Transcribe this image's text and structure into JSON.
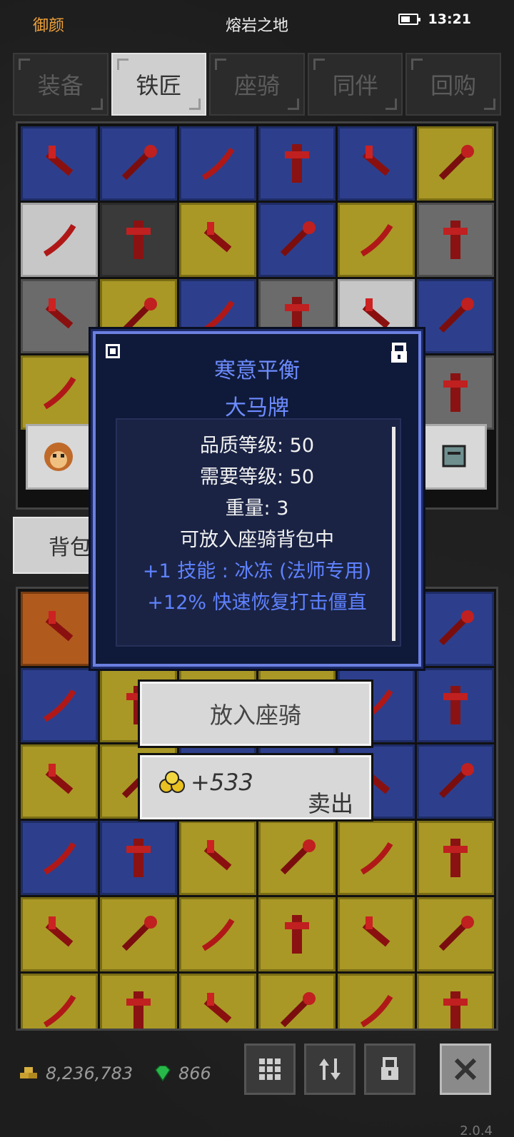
{
  "status_bar": {
    "left_label": "御颜",
    "title": "熔岩之地",
    "time": "13:21"
  },
  "tabs": [
    {
      "label": "装备",
      "active": false
    },
    {
      "label": "铁匠",
      "active": true
    },
    {
      "label": "座骑",
      "active": false
    },
    {
      "label": "同伴",
      "active": false
    },
    {
      "label": "回购",
      "active": false
    }
  ],
  "top_grid_colors": [
    "blue",
    "blue",
    "blue",
    "blue",
    "blue",
    "yellow",
    "light",
    "dark",
    "yellow",
    "blue",
    "yellow",
    "gray",
    "gray",
    "yellow",
    "blue",
    "gray",
    "light",
    "blue",
    "yellow",
    "dark",
    "dark",
    "dark",
    "dark",
    "gray"
  ],
  "backpack_tab": {
    "label": "背包"
  },
  "bottom_grid_colors": [
    "orange",
    "blue",
    "blue",
    "blue",
    "blue",
    "blue",
    "blue",
    "yellow",
    "yellow",
    "yellow",
    "blue",
    "blue",
    "yellow",
    "yellow",
    "blue",
    "blue",
    "blue",
    "blue",
    "blue",
    "blue",
    "yellow",
    "yellow",
    "yellow",
    "yellow",
    "yellow",
    "yellow",
    "yellow",
    "yellow",
    "yellow",
    "yellow",
    "yellow",
    "yellow",
    "yellow",
    "yellow",
    "yellow",
    "yellow"
  ],
  "tooltip": {
    "name": "寒意平衡",
    "type": "大马牌",
    "lines": [
      {
        "text": "品质等级: 50",
        "color": "white"
      },
      {
        "text": "需要等级: 50",
        "color": "white"
      },
      {
        "text": "重量: 3",
        "color": "white"
      },
      {
        "text": "可放入座骑背包中",
        "color": "white"
      },
      {
        "text": "+1 技能 : 冰冻 (法师专用)",
        "color": "blue"
      },
      {
        "text": "+12% 快速恢复打击僵直",
        "color": "blue"
      }
    ]
  },
  "actions": {
    "put_in_mount": "放入座骑",
    "sell_price": "+533",
    "sell_label": "卖出"
  },
  "bottom_bar": {
    "gold": "8,236,783",
    "gems": "866",
    "version": "2.0.4"
  },
  "icons": [
    "grid-icon",
    "sort-icon",
    "lock-icon",
    "close-icon"
  ]
}
